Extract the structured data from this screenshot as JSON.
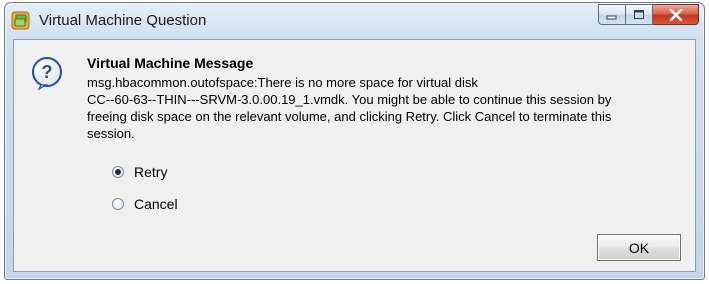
{
  "window": {
    "title": "Virtual Machine Question",
    "title_icon": "vsphere-client-icon",
    "caption_buttons": [
      "minimize-icon",
      "maximize-icon",
      "close-icon"
    ]
  },
  "message": {
    "icon": "question-icon",
    "title": "Virtual Machine Message",
    "lines": [
      "msg.hbacommon.outofspace:There is no more space for virtual disk",
      "CC--60-63--THIN---SRVM-3.0.00.19_1.vmdk. You might be able to continue this session by",
      "freeing disk space on the relevant volume, and clicking Retry. Click Cancel to terminate this",
      "session."
    ]
  },
  "options": [
    {
      "label": "Retry",
      "selected": true
    },
    {
      "label": "Cancel",
      "selected": false
    }
  ],
  "buttons": {
    "ok_label": "OK"
  }
}
